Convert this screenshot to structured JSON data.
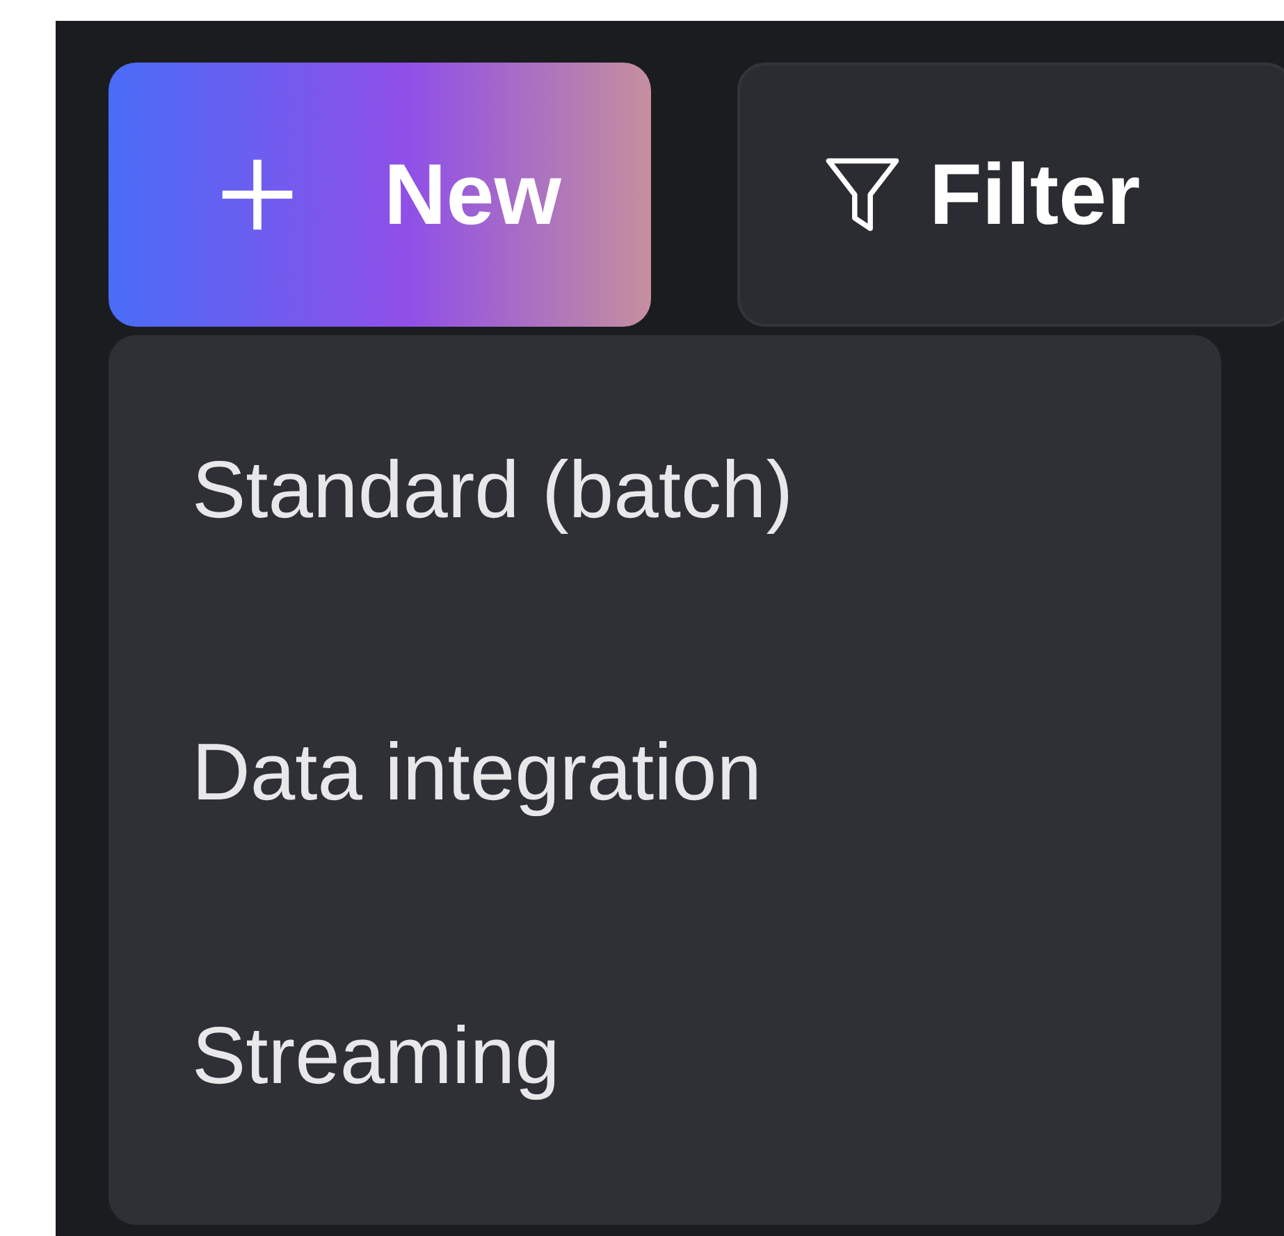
{
  "toolbar": {
    "new_button": {
      "label": "New"
    },
    "filter_button": {
      "label": "Filter"
    }
  },
  "menu": {
    "items": [
      {
        "label": "Standard (batch)"
      },
      {
        "label": "Data integration"
      },
      {
        "label": "Streaming"
      }
    ]
  }
}
